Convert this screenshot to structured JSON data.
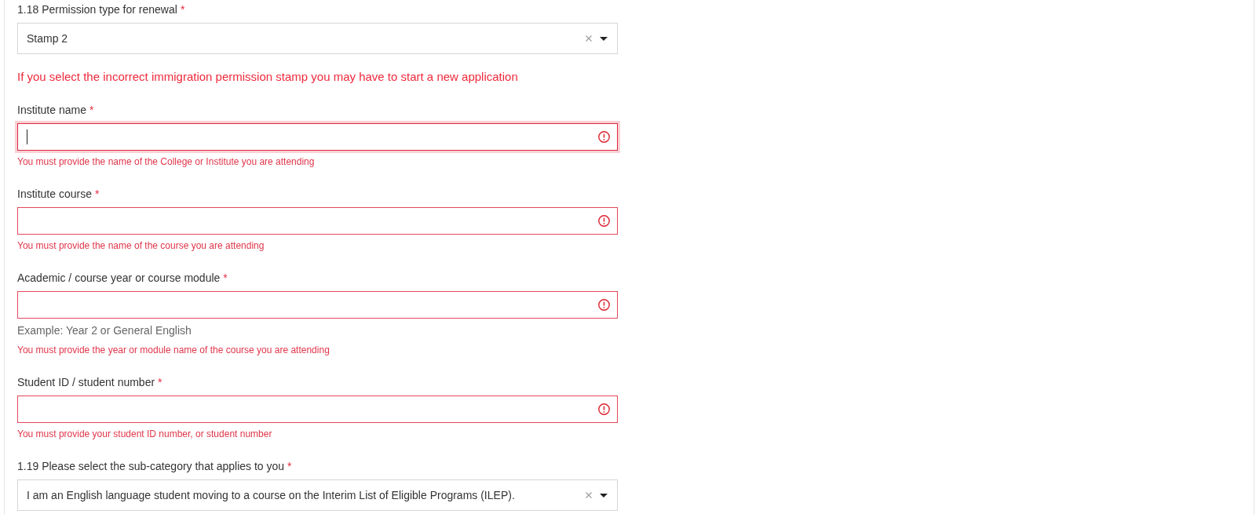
{
  "form_items": [
    {
      "kind": "select",
      "label": "1.18 Permission type for renewal",
      "required_mark": "*",
      "value": "Stamp 2"
    },
    {
      "kind": "notice",
      "text": "If you select the incorrect immigration permission stamp you may have to start a new application"
    },
    {
      "kind": "text_field",
      "label": "Institute name",
      "required_mark": "*",
      "focused": true,
      "invalid": true,
      "error": "You must provide the name of the College or Institute you are attending"
    },
    {
      "kind": "text_field",
      "label": "Institute course",
      "required_mark": "*",
      "focused": false,
      "invalid": true,
      "error": "You must provide the name of the course you are attending"
    },
    {
      "kind": "text_field",
      "label": "Academic / course year or course module",
      "required_mark": "*",
      "focused": false,
      "invalid": true,
      "hint": "Example: Year 2 or General English",
      "error": "You must provide the year or module name of the course you are attending"
    },
    {
      "kind": "text_field",
      "label": "Student ID / student number",
      "required_mark": "*",
      "focused": false,
      "invalid": true,
      "error": "You must provide your student ID number, or student number"
    },
    {
      "kind": "select",
      "label": "1.19 Please select the sub-category that applies to you",
      "required_mark": "*",
      "value": "I am an English language student moving to a course on the Interim List of Eligible Programs (ILEP)."
    }
  ]
}
